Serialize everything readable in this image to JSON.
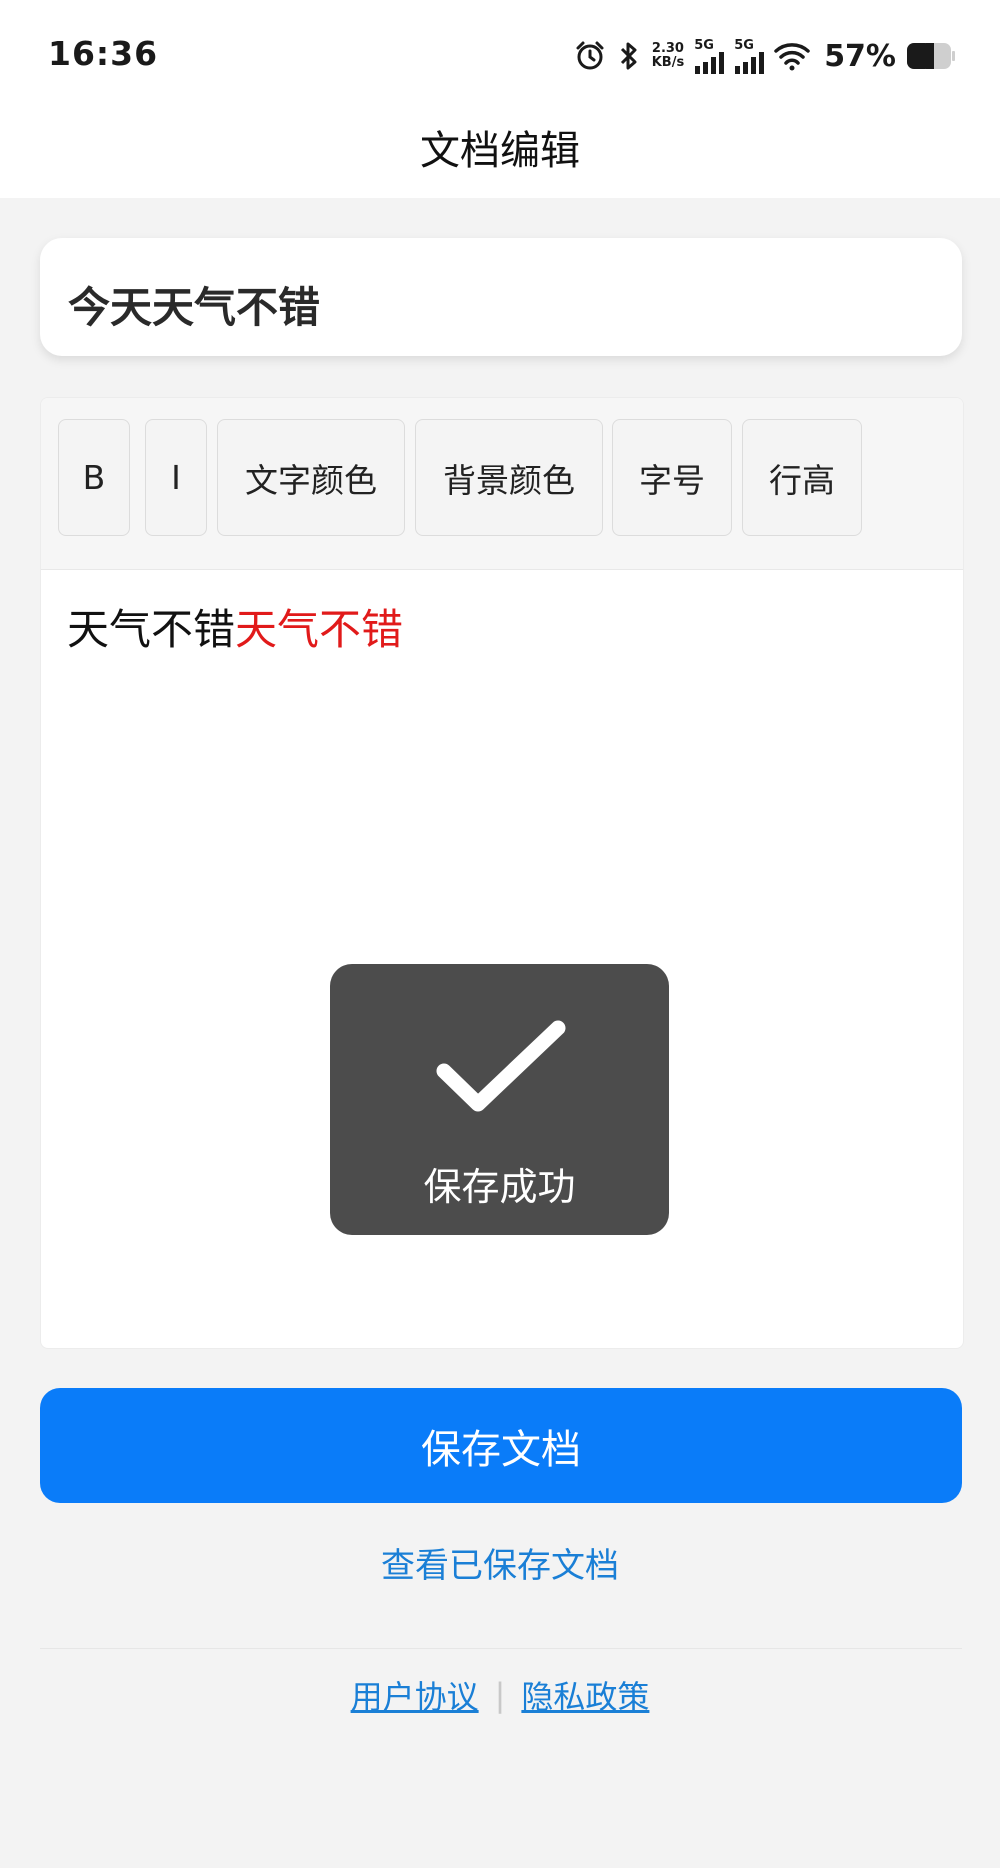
{
  "status_bar": {
    "time": "16:36",
    "net_speed_value": "2.30",
    "net_speed_unit": "KB/s",
    "sim1_label": "5G",
    "sim2_label": "5G",
    "battery_percent": "57%",
    "icons": [
      "alarm-icon",
      "bluetooth-icon",
      "signal-icon",
      "wifi-icon",
      "battery-icon"
    ]
  },
  "header": {
    "title": "文档编辑"
  },
  "document": {
    "title": "今天天气不错"
  },
  "toolbar": {
    "bold": "B",
    "italic": "I",
    "text_color": "文字颜色",
    "bg_color": "背景颜色",
    "font_size": "字号",
    "line_height": "行高"
  },
  "editor": {
    "content_black": "天气不错",
    "content_red": "天气不错",
    "red_color": "#e11a1a"
  },
  "toast": {
    "text": "保存成功",
    "icon": "check-icon"
  },
  "actions": {
    "save_label": "保存文档",
    "view_saved_label": "查看已保存文档"
  },
  "footer": {
    "user_agreement": "用户协议",
    "separator": "|",
    "privacy_policy": "隐私政策"
  },
  "colors": {
    "accent": "#0a7cf9",
    "link": "#1a7fd6",
    "toast_bg": "#4c4c4c"
  }
}
